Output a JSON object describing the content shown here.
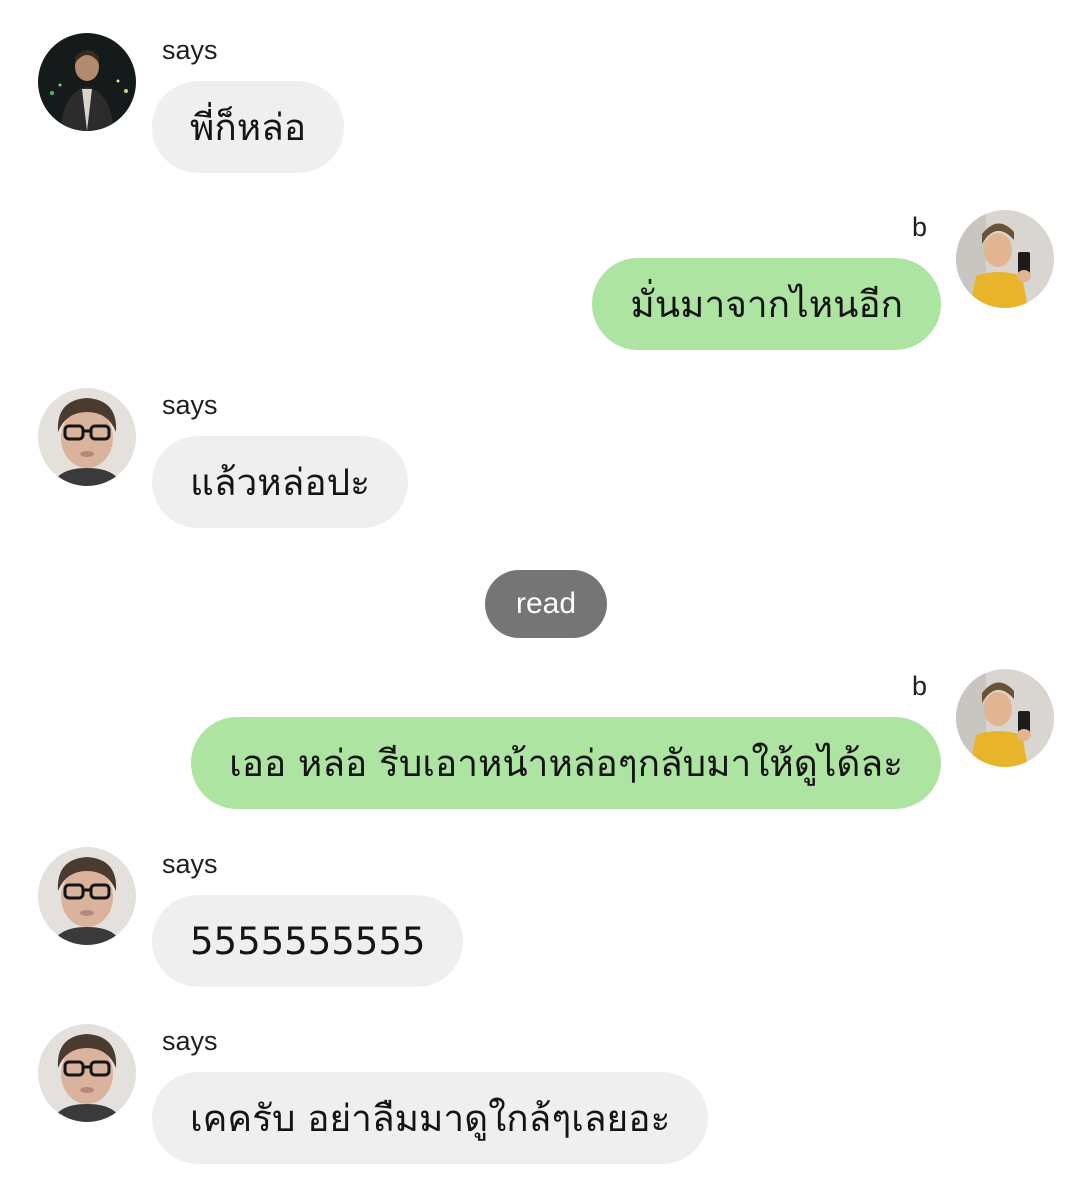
{
  "messages": [
    {
      "side": "incoming",
      "sender": "says",
      "text": "พี่ก็หล่อ",
      "avatar": "night-photo-avatar"
    },
    {
      "side": "outgoing",
      "sender": "b",
      "text": "มั่นมาจากไหนอีก",
      "avatar": "yellow-jersey-avatar"
    },
    {
      "side": "incoming",
      "sender": "says",
      "text": "แล้วหล่อปะ",
      "avatar": "glasses-avatar"
    },
    {
      "side": "outgoing",
      "sender": "b",
      "text": "เออ หล่อ รีบเอาหน้าหล่อๆกลับมาให้ดูได้ละ",
      "avatar": "yellow-jersey-avatar"
    },
    {
      "side": "incoming",
      "sender": "says",
      "text": "5555555555",
      "avatar": "glasses-avatar"
    },
    {
      "side": "incoming",
      "sender": "says",
      "text": "เคครับ อย่าลืมมาดูใกล้ๆเลยอะ",
      "avatar": "glasses-avatar"
    }
  ],
  "status": {
    "read_label": "read"
  },
  "colors": {
    "incoming_bubble": "#efefef",
    "outgoing_bubble": "#aee4a1",
    "read_pill": "#757575"
  }
}
